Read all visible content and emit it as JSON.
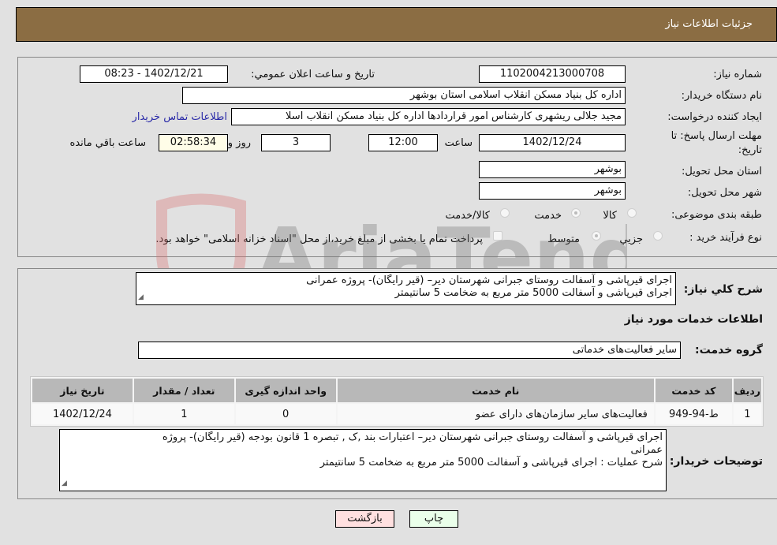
{
  "header": {
    "title": "جزئيات اطلاعات نياز"
  },
  "fields": {
    "need_number_label": "شماره نیاز:",
    "need_number": "1102004213000708",
    "announce_label": "تاریخ و ساعت اعلان عمومي:",
    "announce_value": "1402/12/21 - 08:23",
    "buyer_org_label": "نام دستگاه خریدار:",
    "buyer_org": "اداره کل بنیاد مسکن انقلاب اسلامی استان بوشهر",
    "creator_label": "ایجاد کننده درخواست:",
    "creator": "مجید جلالی ریشهری کارشناس امور قراردادها اداره کل بنیاد مسکن انقلاب اسلا",
    "contact_link": "اطلاعات تماس خریدار",
    "deadline_label_1": "مهلت ارسال پاسخ: تا",
    "deadline_label_2": "تاریخ:",
    "deadline_date": "1402/12/24",
    "time_label": "ساعت",
    "deadline_time": "12:00",
    "days_value": "3",
    "days_label": "روز و",
    "remaining_time": "02:58:34",
    "remaining_label": "ساعت باقي مانده",
    "province_label": "استان محل تحویل:",
    "province": "بوشهر",
    "city_label": "شهر محل تحویل:",
    "city": "بوشهر",
    "category_label": "طبقه بندی موضوعی:",
    "category_options": [
      "کالا",
      "خدمت",
      "کالا/خدمت"
    ],
    "category_selected": "خدمت",
    "process_label": "نوع فرآیند خرید :",
    "process_options": [
      "جزیي",
      "متوسط"
    ],
    "process_selected": "متوسط",
    "treasury_note": "پرداخت تمام یا بخشی از مبلغ خرید،از محل \"اسناد خزانه اسلامی\" خواهد بود."
  },
  "description": {
    "label": "شرح کلي نياز:",
    "lines": [
      "اجرای قیرپاشی و آسفالت روستای جبرانی شهرستان دیر– (قیر رایگان)- پروژه عمرانی",
      "اجرای قیرپاشی و آسفالت  5000 متر مربع به ضخامت 5 سانتیمتر"
    ]
  },
  "services": {
    "section_title": "اطلاعات خدمات مورد نياز",
    "group_label": "گروه خدمت:",
    "group_value": "سایر فعالیت‌های خدماتی",
    "table": {
      "headers": [
        "ردیف",
        "کد خدمت",
        "نام خدمت",
        "واحد اندازه گیری",
        "تعداد / مقدار",
        "تاریخ نیاز"
      ],
      "rows": [
        [
          "1",
          "ط-94-949",
          "فعالیت‌های سایر سازمان‌های دارای عضو",
          "0",
          "1",
          "1402/12/24"
        ]
      ]
    }
  },
  "buyer_notes": {
    "label": "توضیحات خریدار:",
    "lines": [
      "اجرای قیرپاشی و آسفالت روستای جبرانی شهرستان دیر– اعتبارات بند ,ک , تبصره 1 قانون بودجه (قیر رایگان)- پروژه",
      "عمرانی",
      "شرح عملیات : اجرای قیرپاشی و آسفالت  5000 متر مربع به ضخامت 5 سانتیمتر"
    ]
  },
  "buttons": {
    "print": "چاپ",
    "back": "بازگشت"
  },
  "watermark": {
    "text": "AriaTender.neT"
  }
}
